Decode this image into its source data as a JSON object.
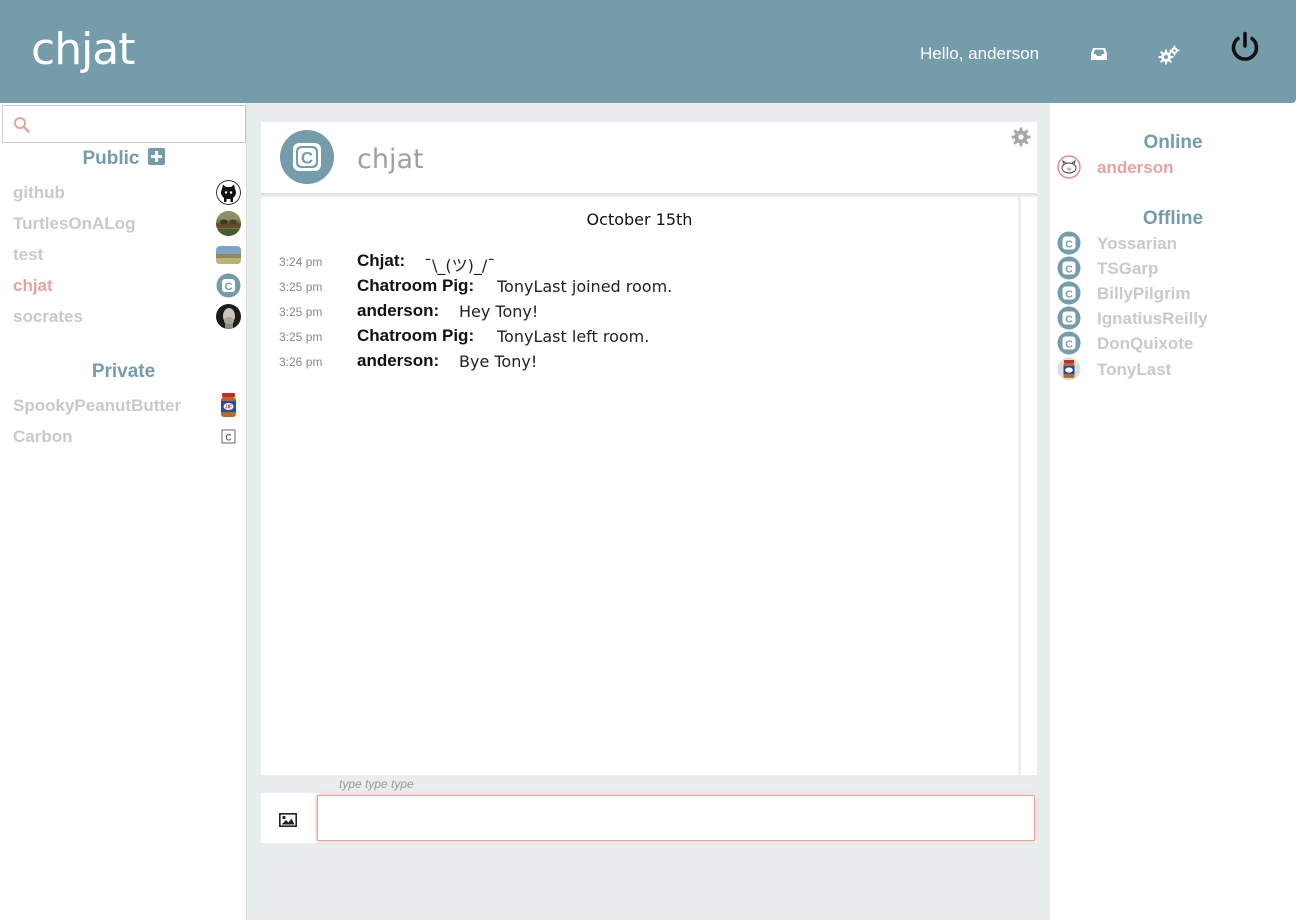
{
  "header": {
    "brand": "chjat",
    "greeting": "Hello, anderson",
    "icons": [
      "inbox-icon",
      "gears-icon",
      "power-icon"
    ]
  },
  "left_sidebar": {
    "search": {
      "value": "",
      "placeholder": ""
    },
    "public_title": "Public",
    "public_rooms": [
      {
        "name": "github",
        "avatar": "github-octocat-icon",
        "active": false
      },
      {
        "name": "TurtlesOnALog",
        "avatar": "turtles-photo",
        "active": false
      },
      {
        "name": "test",
        "avatar": "landscape-photo",
        "active": false
      },
      {
        "name": "chjat",
        "avatar": "chjat-logo-icon",
        "active": true
      },
      {
        "name": "socrates",
        "avatar": "socrates-bust-photo",
        "active": false
      }
    ],
    "private_title": "Private",
    "private_rooms": [
      {
        "name": "SpookyPeanutButter",
        "avatar": "peanut-butter-jar-photo"
      },
      {
        "name": "Carbon",
        "avatar": "c-box-icon"
      }
    ]
  },
  "room": {
    "title": "chjat",
    "date": "October 15th",
    "messages": [
      {
        "time": "3:24 pm",
        "author": "Chjat:",
        "text": "¯\\_(ツ)_/¯"
      },
      {
        "time": "3:25 pm",
        "author": "Chatroom Pig:",
        "text": "TonyLast joined room."
      },
      {
        "time": "3:25 pm",
        "author": "anderson:",
        "text": "Hey Tony!"
      },
      {
        "time": "3:25 pm",
        "author": "Chatroom Pig:",
        "text": "TonyLast left room."
      },
      {
        "time": "3:26 pm",
        "author": "anderson:",
        "text": "Bye Tony!"
      }
    ],
    "typing": "type type type",
    "composer": {
      "value": "",
      "placeholder": ""
    }
  },
  "right_sidebar": {
    "online_title": "Online",
    "online": [
      {
        "name": "anderson",
        "avatar": "pig-sketch-avatar"
      }
    ],
    "offline_title": "Offline",
    "offline": [
      {
        "name": "Yossarian",
        "avatar": "chjat-logo-icon"
      },
      {
        "name": "TSGarp",
        "avatar": "chjat-logo-icon"
      },
      {
        "name": "BillyPilgrim",
        "avatar": "chjat-logo-icon"
      },
      {
        "name": "IgnatiusReilly",
        "avatar": "chjat-logo-icon"
      },
      {
        "name": "DonQuixote",
        "avatar": "chjat-logo-icon"
      },
      {
        "name": "TonyLast",
        "avatar": "peanut-butter-jar-photo"
      }
    ]
  },
  "colors": {
    "header": "#749cab",
    "accent": "#749cab",
    "active": "#e8a2a2",
    "muted": "#c9c9c9",
    "main_bg": "#e9eded"
  }
}
